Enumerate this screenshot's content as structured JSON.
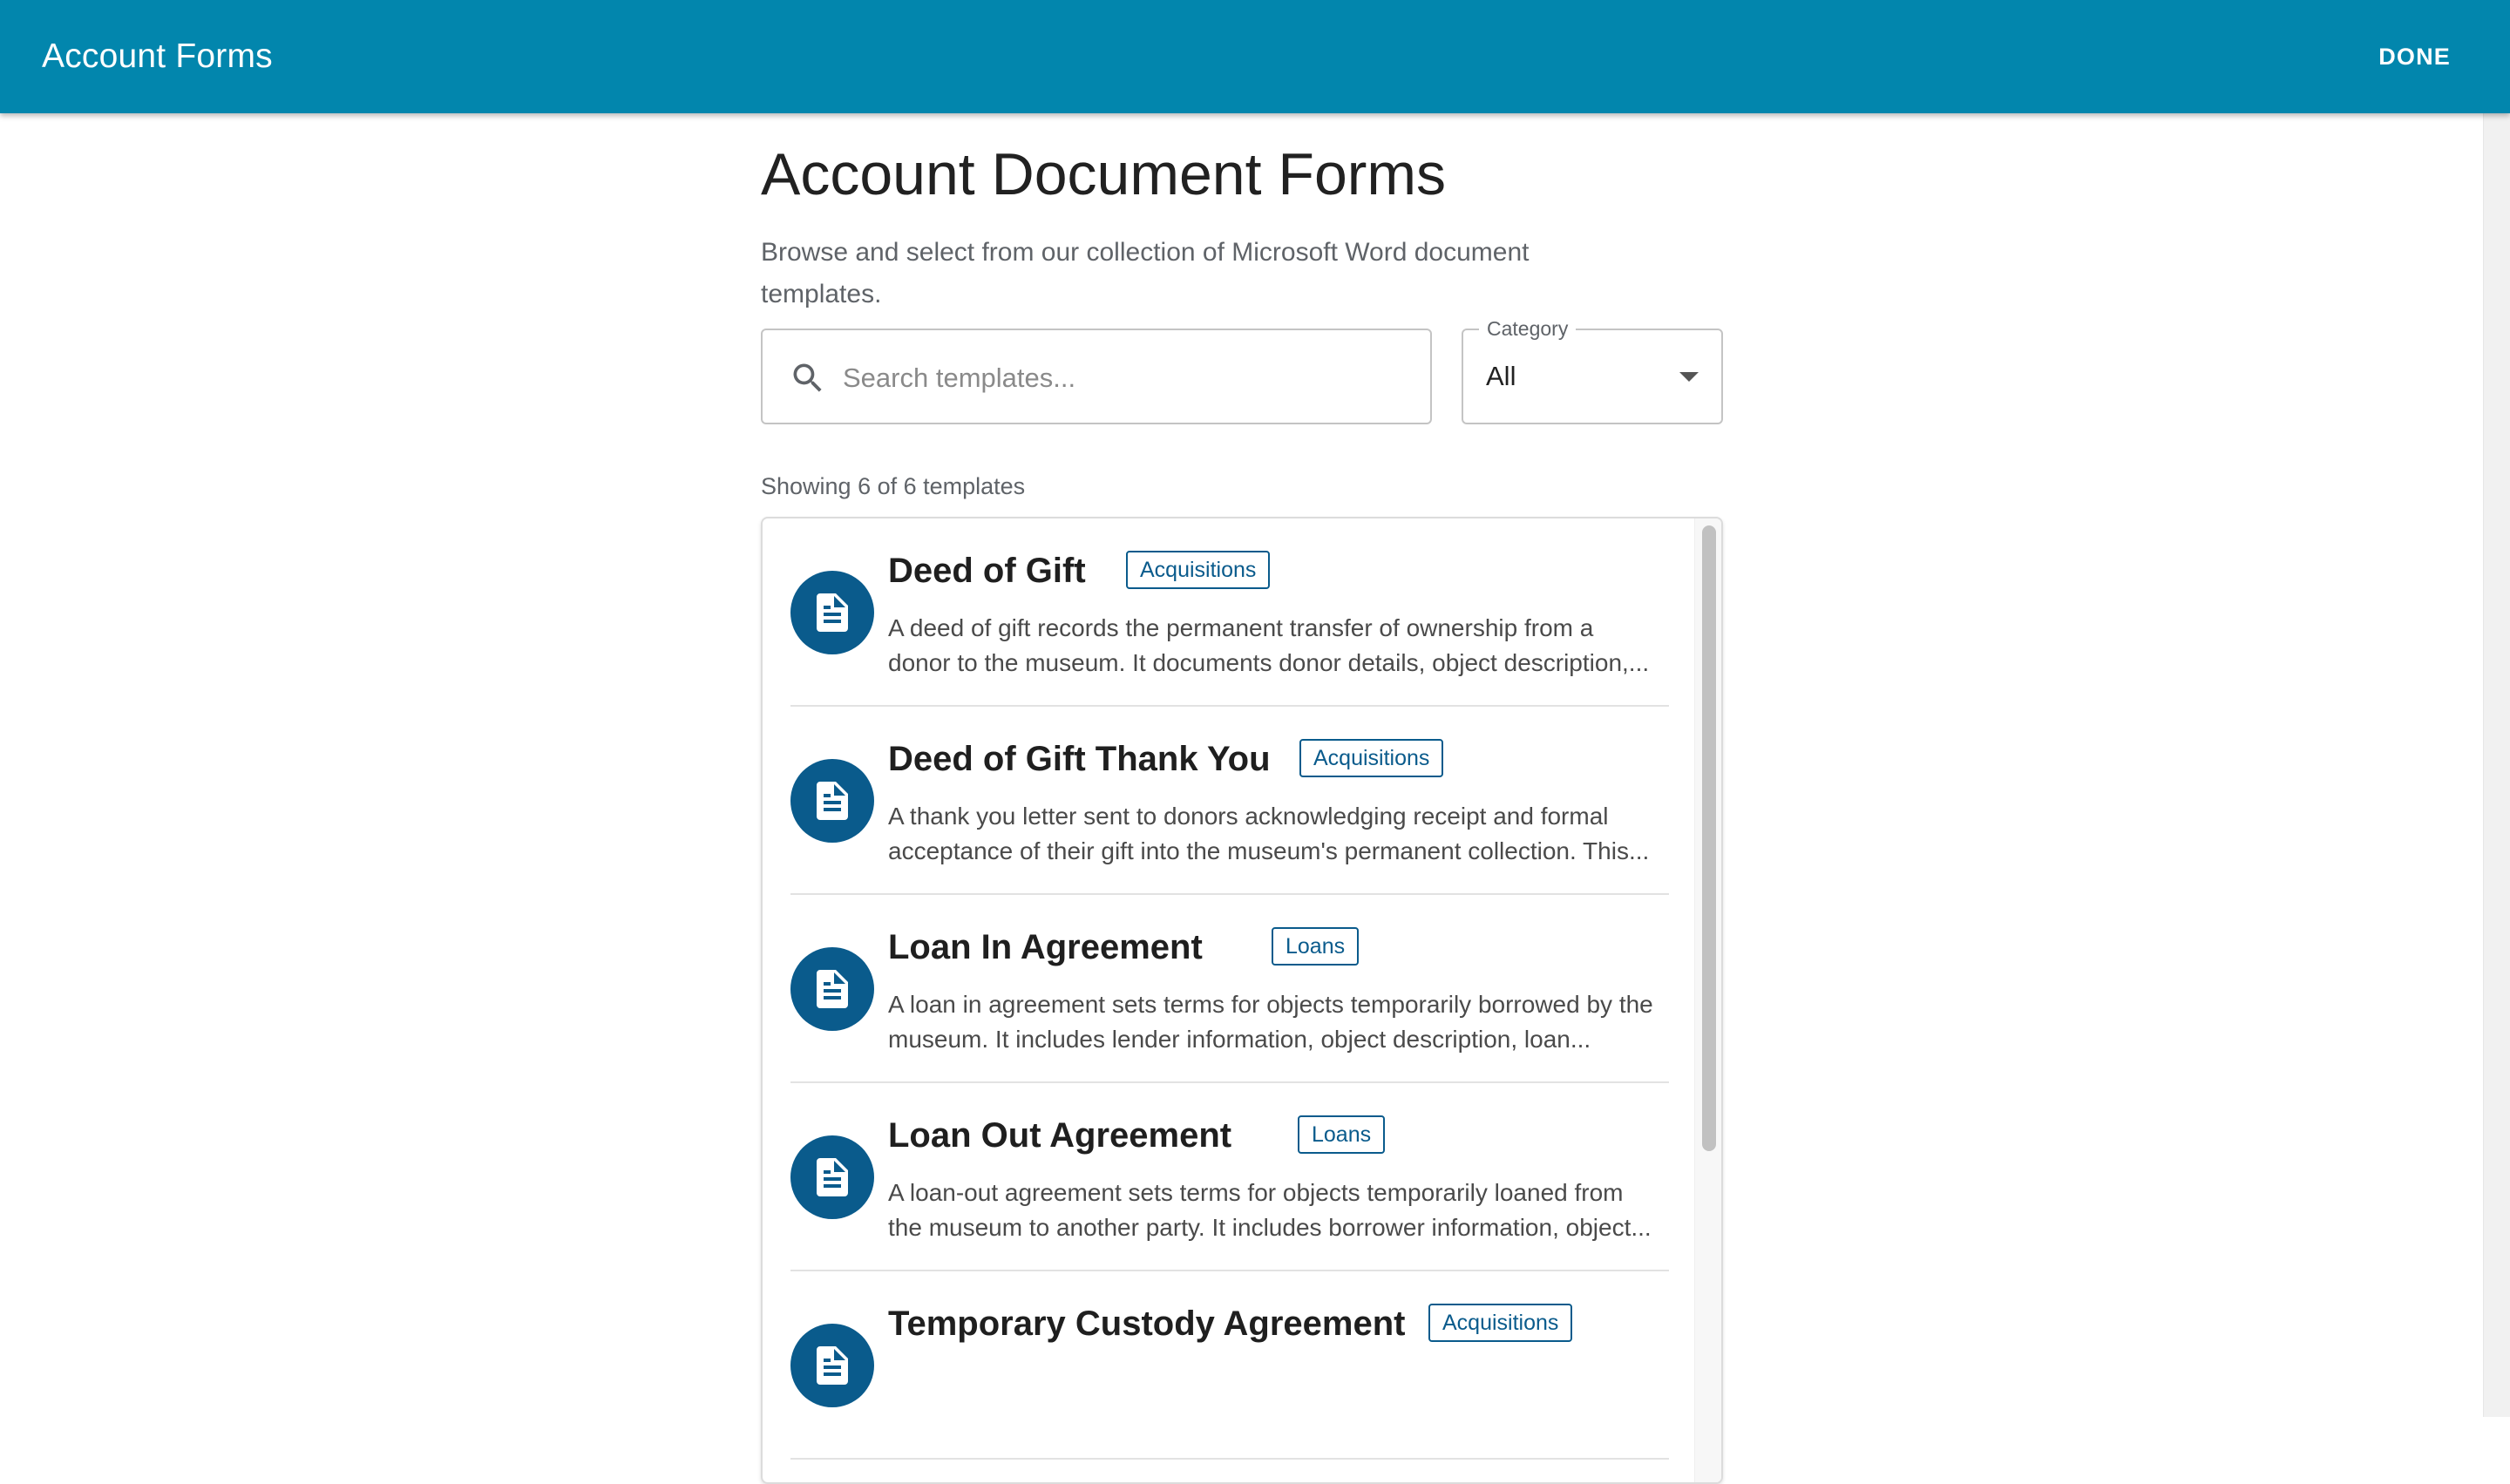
{
  "appbar": {
    "title": "Account Forms",
    "done_label": "DONE"
  },
  "page": {
    "title": "Account Document Forms",
    "subtitle_line1": "Browse and select from our collection of Microsoft Word document",
    "subtitle_line2": "templates."
  },
  "search": {
    "placeholder": "Search templates...",
    "value": "",
    "icon": "search-icon"
  },
  "category": {
    "label": "Category",
    "selected": "All",
    "icon": "caret-down-icon"
  },
  "results": {
    "count_text": "Showing 6 of 6 templates"
  },
  "templates": [
    {
      "title": "Deed of Gift",
      "category": "Acquisitions",
      "icon": "document-icon",
      "desc_line1": "A deed of gift records the permanent transfer of ownership from a",
      "desc_line2": "donor to the museum. It documents donor details, object description,..."
    },
    {
      "title": "Deed of Gift Thank You",
      "category": "Acquisitions",
      "icon": "document-icon",
      "desc_line1": "A thank you letter sent to donors acknowledging receipt and formal",
      "desc_line2": "acceptance of their gift into the museum's permanent collection. This..."
    },
    {
      "title": "Loan In Agreement",
      "category": "Loans",
      "icon": "document-icon",
      "desc_line1": "A loan in agreement sets terms for objects temporarily borrowed by the",
      "desc_line2": "museum. It includes lender information, object description, loan..."
    },
    {
      "title": "Loan Out Agreement",
      "category": "Loans",
      "icon": "document-icon",
      "desc_line1": "A loan-out agreement sets terms for objects temporarily loaned from",
      "desc_line2": "the museum to another party. It includes borrower information, object..."
    },
    {
      "title": "Temporary Custody Agreement",
      "category": "Acquisitions",
      "icon": "document-icon",
      "desc_line1": "",
      "desc_line2": ""
    }
  ],
  "colors": {
    "appbar": "#0286ad",
    "accent": "#0a5b8c"
  }
}
